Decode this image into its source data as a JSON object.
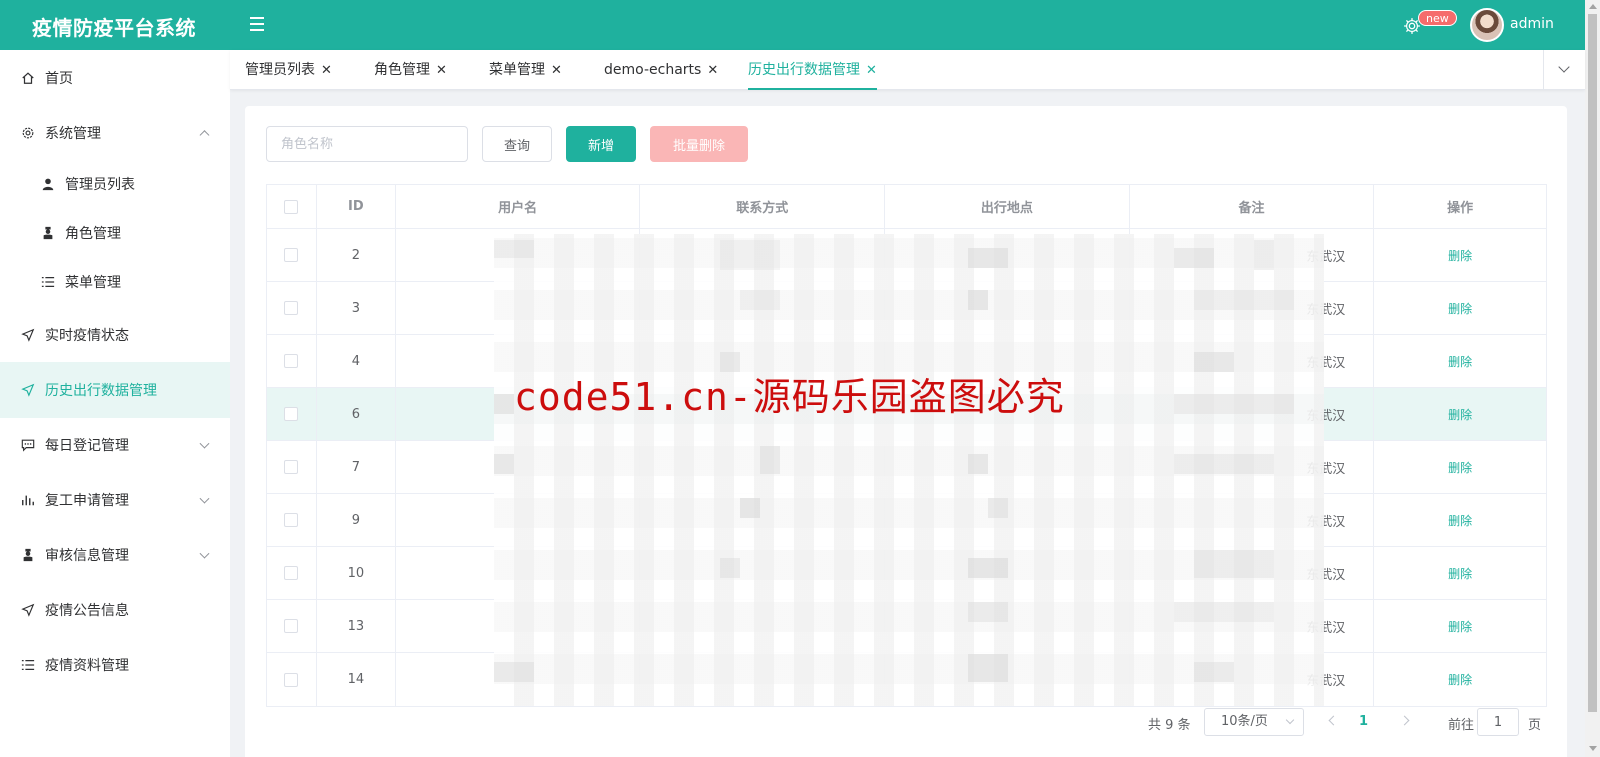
{
  "header": {
    "title": "疫情防疫平台系统",
    "badge": "new",
    "username": "admin"
  },
  "sidebar": {
    "items": [
      {
        "label": "首页",
        "icon": "home-icon"
      },
      {
        "label": "系统管理",
        "icon": "gear-icon",
        "expanded": true
      },
      {
        "label": "管理员列表",
        "icon": "user-icon",
        "sub": true
      },
      {
        "label": "角色管理",
        "icon": "role-icon",
        "sub": true
      },
      {
        "label": "菜单管理",
        "icon": "list-icon",
        "sub": true
      },
      {
        "label": "实时疫情状态",
        "icon": "send-icon"
      },
      {
        "label": "历史出行数据管理",
        "icon": "send-icon",
        "active": true
      },
      {
        "label": "每日登记管理",
        "icon": "chat-icon",
        "expandable": true
      },
      {
        "label": "复工申请管理",
        "icon": "bar-chart-icon",
        "expandable": true
      },
      {
        "label": "审核信息管理",
        "icon": "role-icon",
        "expandable": true
      },
      {
        "label": "疫情公告信息",
        "icon": "send-icon"
      },
      {
        "label": "疫情资料管理",
        "icon": "list-icon"
      }
    ]
  },
  "tabs": [
    {
      "label": "管理员列表"
    },
    {
      "label": "角色管理"
    },
    {
      "label": "菜单管理"
    },
    {
      "label": "demo-echarts"
    },
    {
      "label": "历史出行数据管理",
      "active": true
    }
  ],
  "toolbar": {
    "search_placeholder": "角色名称",
    "query_label": "查询",
    "add_label": "新增",
    "batch_delete_label": "批量删除"
  },
  "table": {
    "columns": [
      "ID",
      "用户名",
      "联系方式",
      "出行地点",
      "备注",
      "操作"
    ],
    "rows": [
      {
        "id": "2",
        "note": "东武汉",
        "action": "删除"
      },
      {
        "id": "3",
        "note": "东武汉",
        "action": "删除"
      },
      {
        "id": "4",
        "note": "东武汉",
        "action": "删除"
      },
      {
        "id": "6",
        "note": "东武汉",
        "action": "删除"
      },
      {
        "id": "7",
        "note": "东武汉",
        "action": "删除"
      },
      {
        "id": "9",
        "note": "东武汉",
        "action": "删除"
      },
      {
        "id": "10",
        "note": "东武汉",
        "action": "删除"
      },
      {
        "id": "13",
        "note": "东武汉",
        "action": "删除"
      },
      {
        "id": "14",
        "note": "东武汉",
        "action": "删除"
      }
    ]
  },
  "watermark": "code51.cn-源码乐园盗图必究",
  "pagination": {
    "total": "共 9 条",
    "page_size": "10条/页",
    "current_page": "1",
    "goto_label": "前往",
    "goto_value": "1",
    "goto_unit": "页"
  },
  "colors": {
    "brand": "#1fb19e",
    "danger_light": "#fab6b6",
    "watermark": "#cc0d0d"
  }
}
